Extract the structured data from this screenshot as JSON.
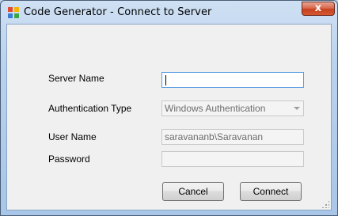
{
  "window": {
    "title": "Code Generator - Connect to Server",
    "close_glyph": "x"
  },
  "form": {
    "server_name_label": "Server Name",
    "server_name_value": "",
    "auth_type_label": "Authentication Type",
    "auth_type_value": "Windows Authentication",
    "user_name_label": "User Name",
    "user_name_value": "saravananb\\Saravanan",
    "password_label": "Password",
    "password_value": ""
  },
  "buttons": {
    "cancel_label": "Cancel",
    "connect_label": "Connect"
  },
  "colors": {
    "focus_border": "#569de5",
    "close_button": "#c7401f"
  },
  "icons": {
    "app": "app-window-icon",
    "close": "close-icon",
    "combo": "chevron-down-icon",
    "grip": "resize-grip-icon"
  }
}
